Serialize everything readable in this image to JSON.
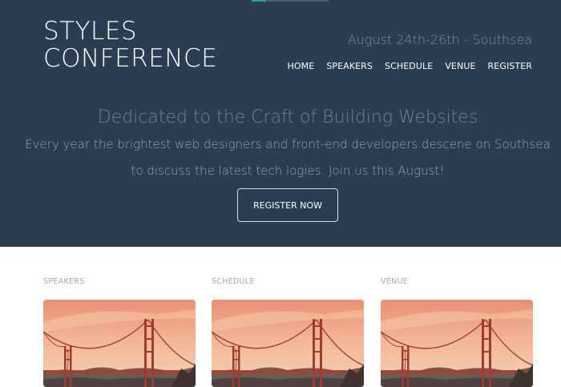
{
  "header": {
    "logo_line1": "STYLES",
    "logo_line2": "CONFERENCE",
    "dates": "August 24th-26th - Southsea",
    "nav": [
      "HOME",
      "SPEAKERS",
      "SCHEDULE",
      "VENUE",
      "REGISTER"
    ]
  },
  "hero": {
    "tagline": "Dedicated to the Craft of Building Websites",
    "lead_line1": "Every year the brightest web designers and front-end developers descene on Southsea",
    "lead_line2": "to discuss the latest tech logies. Join us this August!",
    "cta": "REGISTER NOW"
  },
  "sections": [
    {
      "label": "SPEAKERS",
      "image": "golden-gate-bridge-photo"
    },
    {
      "label": "SCHEDULE",
      "image": "golden-gate-bridge-photo"
    },
    {
      "label": "VENUE",
      "image": "golden-gate-bridge-photo"
    }
  ],
  "colors": {
    "hero_bg": "#2b3d50",
    "accent": "#2aa58a",
    "muted_text": "#7e8f9f"
  }
}
